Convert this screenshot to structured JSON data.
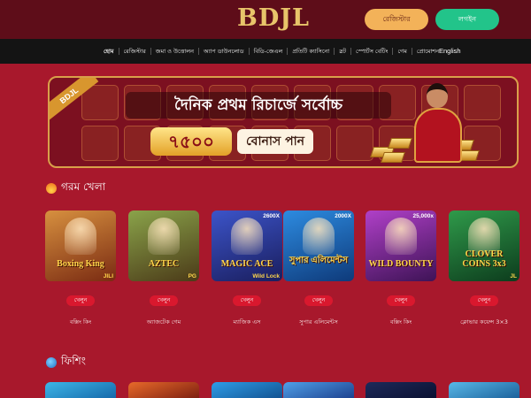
{
  "header": {
    "logo": "BDJL",
    "login_label": "রেজিস্টার",
    "register_label": "লগইন"
  },
  "nav": {
    "items": [
      "হোম",
      "রেজিস্টার",
      "জমা ও উত্তোলন",
      "অ্যাপ ডাউনলোড",
      "বিডি-জেএল",
      "প্রতিটি ক্যাসিনো",
      "স্লট",
      "স্পোর্টস বেটিং",
      "গেম",
      "প্রোমোশন"
    ],
    "language": "English"
  },
  "banner": {
    "tag": "BDJL",
    "headline": "দৈনিক প্রথম রিচার্জে সর্বোচ্চ",
    "amount": "৭৫০০",
    "bonus_text": "বোনাস পান"
  },
  "hot_section": {
    "title": "গরম খেলা",
    "icon": "fire-icon",
    "games": [
      {
        "title": "Boxing King",
        "mark": "JILI",
        "badge": "",
        "name": "বক্সিং কিং",
        "play": "খেলুন",
        "colors": [
          "#d7903f",
          "#7a2b12"
        ]
      },
      {
        "title": "AZTEC",
        "mark": "PG",
        "badge": "",
        "name": "অ্যাজটেক গেম",
        "play": "খেলুন",
        "colors": [
          "#8aa34a",
          "#4b3a18"
        ]
      },
      {
        "title": "MAGIC ACE",
        "mark": "Wild Lock",
        "badge": "2600X",
        "name": "ম্যাজিক এস",
        "play": "খেলুন",
        "colors": [
          "#3c54c9",
          "#1a1e5e"
        ]
      },
      {
        "title": "সুপার এলিমেন্টস",
        "mark": "",
        "badge": "2000X",
        "name": "সুপার এলিমেন্টস",
        "play": "খেলুন",
        "colors": [
          "#2d8be0",
          "#0e3a7a"
        ]
      },
      {
        "title": "WILD BOUNTY",
        "mark": "",
        "badge": "25,000x",
        "name": "বক্সিং কিং",
        "play": "খেলুন",
        "colors": [
          "#b040c8",
          "#3e1356"
        ]
      },
      {
        "title": "CLOVER COINS 3x3",
        "mark": "JL",
        "badge": "",
        "name": "ক্লোভার কয়েন্স 3×3",
        "play": "খেলুন",
        "colors": [
          "#2f9a4a",
          "#0d3c1d"
        ]
      }
    ]
  },
  "fishing_section": {
    "title": "ফিশিং",
    "icon": "fish-icon",
    "cards": [
      {
        "colors": [
          "#3db6e8",
          "#1466a8"
        ]
      },
      {
        "colors": [
          "#e86a2a",
          "#7a1d10"
        ]
      },
      {
        "colors": [
          "#2e9de8",
          "#12508e"
        ]
      },
      {
        "colors": [
          "#4fa0e8",
          "#1c3e8c"
        ]
      },
      {
        "colors": [
          "#1d2a5a",
          "#0a1030"
        ]
      },
      {
        "colors": [
          "#58b8e8",
          "#1a5e98"
        ]
      }
    ]
  },
  "colors": {
    "page_bg": "#a8182c",
    "topbar_bg": "#5e0d19",
    "navbar_bg": "#141414",
    "accent_gold": "#e8c46a",
    "register_green": "#22c48a",
    "play_red": "#d9182e"
  }
}
